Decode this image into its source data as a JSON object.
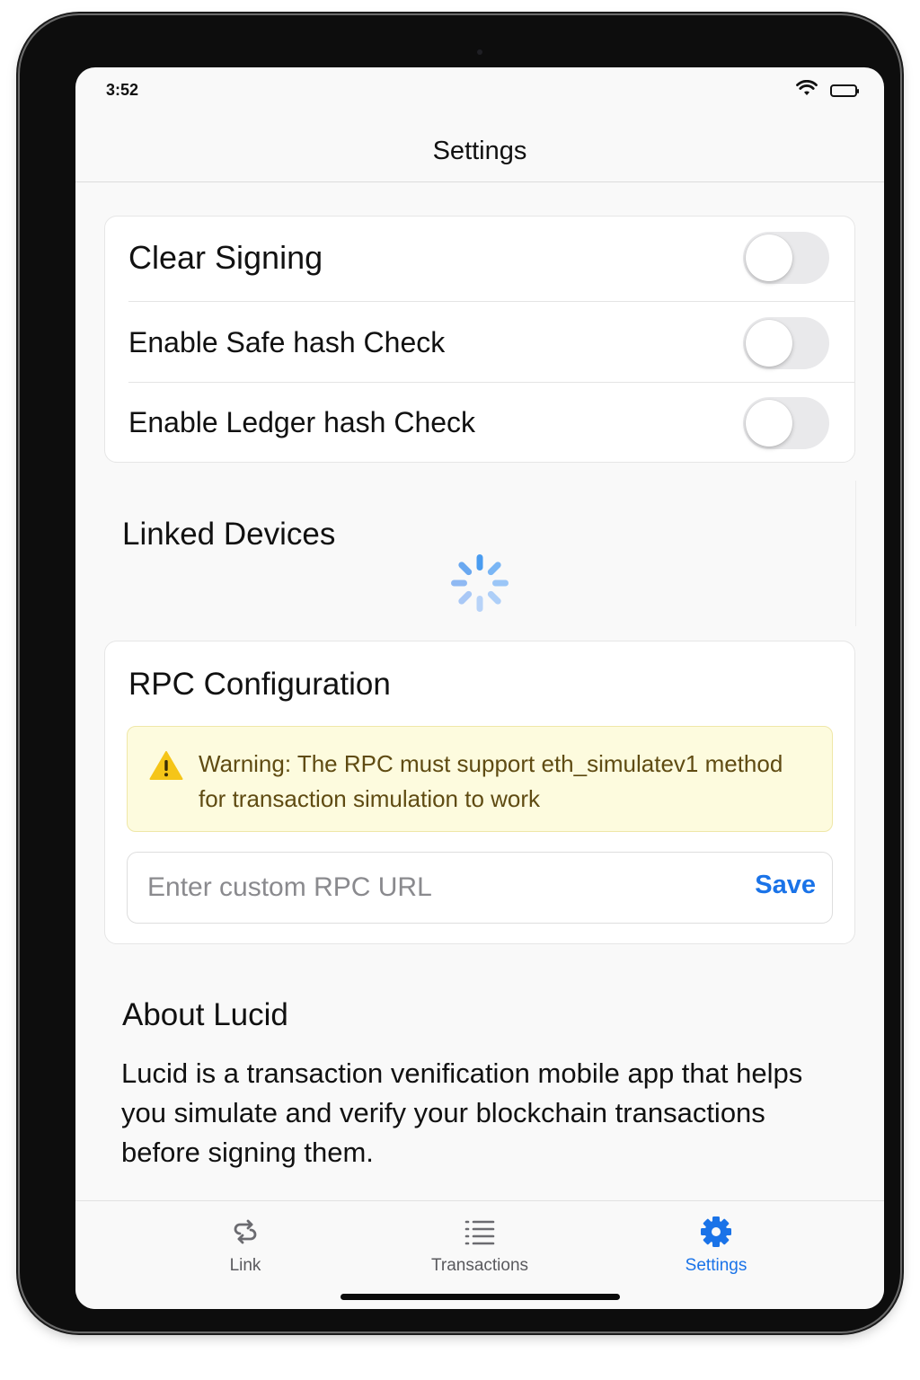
{
  "status_bar": {
    "time": "3:52",
    "wifi_icon": "wifi-icon",
    "battery_icon": "battery-full-icon"
  },
  "nav": {
    "title": "Settings"
  },
  "toggles": [
    {
      "label": "Clear Signing",
      "on": false
    },
    {
      "label": "Enable Safe hash Check",
      "on": false
    },
    {
      "label": "Enable Ledger hash Check",
      "on": false
    }
  ],
  "linked_devices": {
    "heading": "Linked Devices",
    "loading": true,
    "spinner_icon": "spinner-icon"
  },
  "rpc": {
    "title": "RPC Configuration",
    "warning_icon": "warning-triangle-icon",
    "warning": "Warning: The RPC must support eth_simulatev1 method for transaction simulation to work",
    "url_value": "",
    "url_placeholder": "Enter custom RPC URL",
    "save_label": "Save"
  },
  "about": {
    "heading": "About Lucid",
    "text": "Lucid is a transaction venification mobile app that helps you simulate and verify your blockchain transactions before signing them."
  },
  "tabs": [
    {
      "label": "Link",
      "icon": "link-arrows-icon",
      "active": false
    },
    {
      "label": "Transactions",
      "icon": "list-icon",
      "active": false
    },
    {
      "label": "Settings",
      "icon": "gear-icon",
      "active": true
    }
  ],
  "colors": {
    "accent": "#1a73e8",
    "warning_bg": "#fdfbde",
    "warning_text": "#5f4b12",
    "warning_icon": "#f5c518",
    "switch_off": "#e9e9eb"
  }
}
